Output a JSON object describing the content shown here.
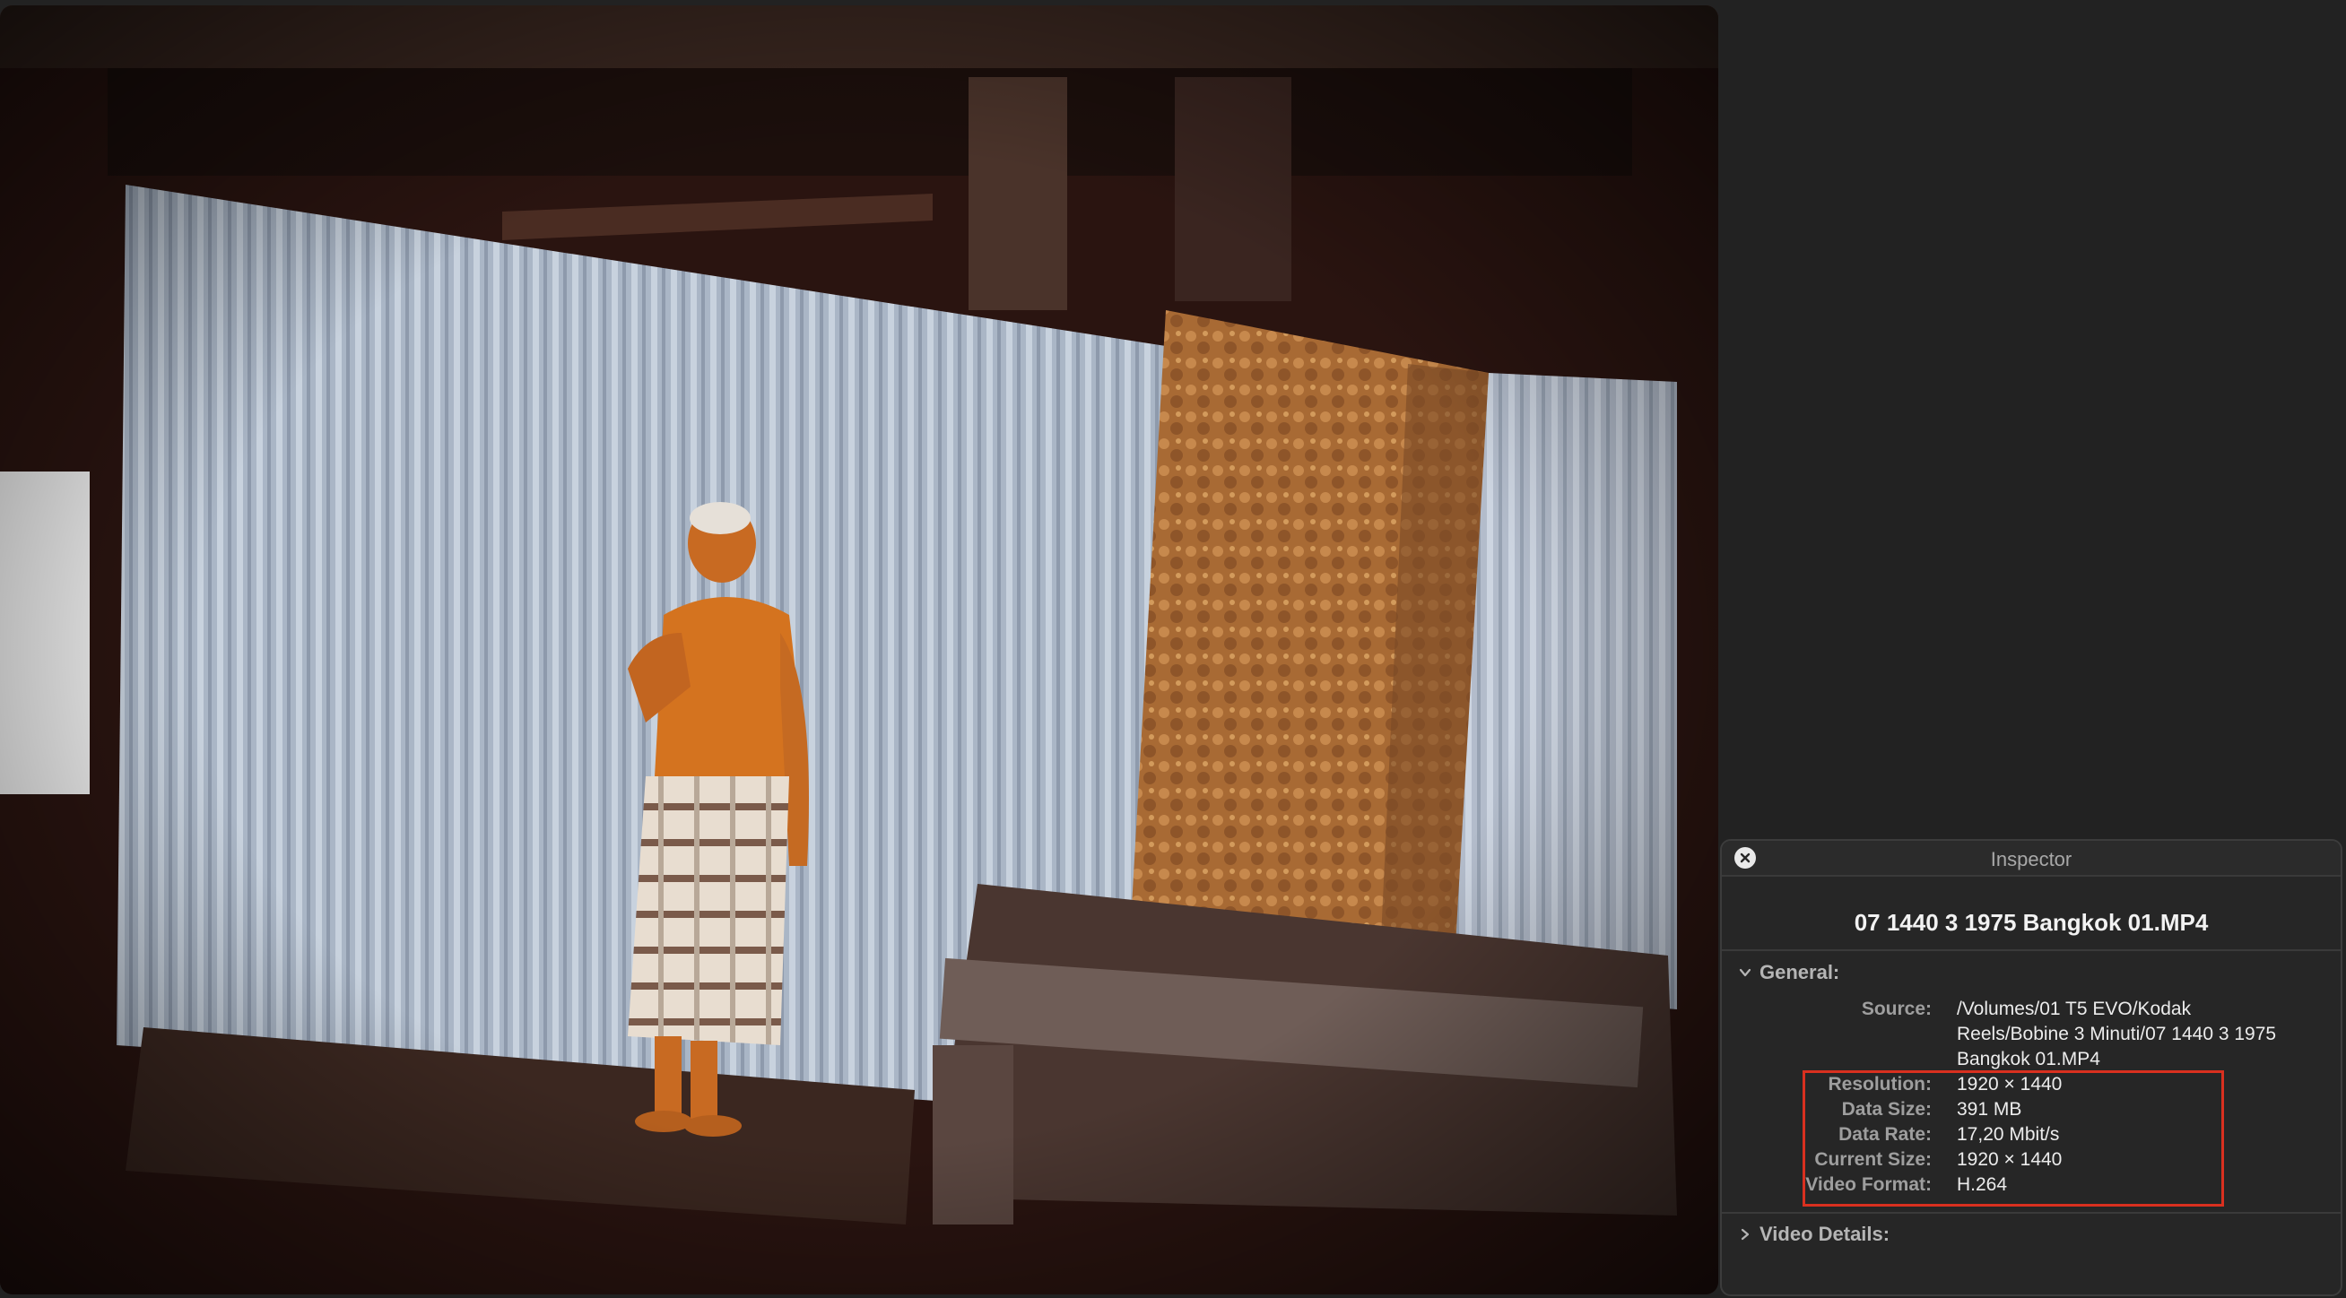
{
  "inspector": {
    "title": "Inspector",
    "close_icon": "close-icon",
    "filename": "07 1440 3 1975 Bangkok 01.MP4",
    "general": {
      "label": "General:",
      "expanded": true,
      "rows": [
        {
          "key": "Source:",
          "value": "/Volumes/01 T5 EVO/Kodak Reels/Bobine 3 Minuti/07 1440 3 1975 Bangkok 01.MP4"
        },
        {
          "key": "Resolution:",
          "value": "1920 × 1440"
        },
        {
          "key": "Data Size:",
          "value": "391 MB"
        },
        {
          "key": "Data Rate:",
          "value": "17,20 Mbit/s"
        },
        {
          "key": "Current Size:",
          "value": "1920 × 1440"
        },
        {
          "key": "Video Format:",
          "value": "H.264"
        }
      ]
    },
    "video_details": {
      "label": "Video Details:",
      "expanded": false
    },
    "highlight_color": "#d9301f"
  }
}
